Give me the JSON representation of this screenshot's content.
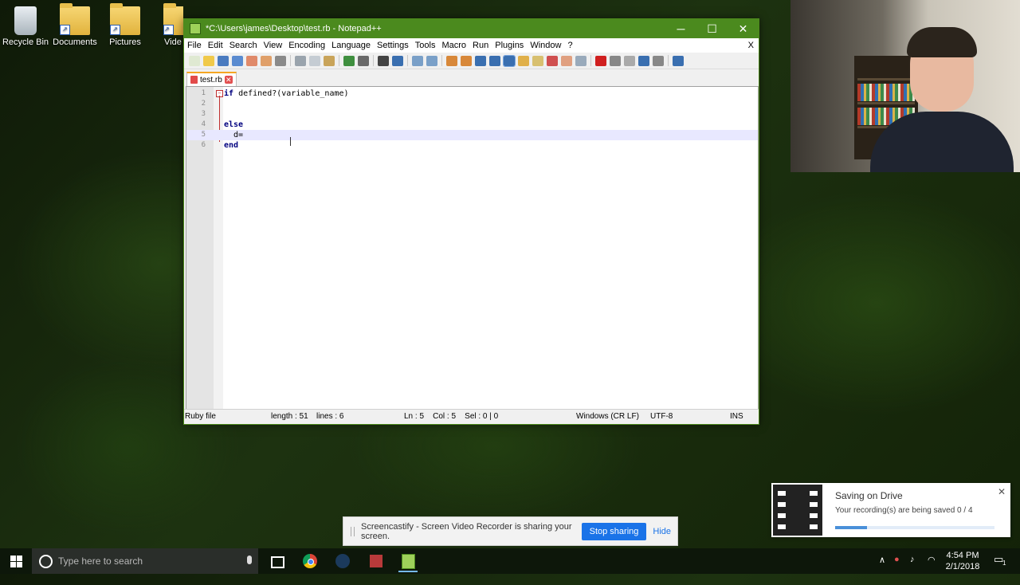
{
  "desktop_icons": [
    {
      "label": "Recycle Bin",
      "icon": "recycle-bin-icon"
    },
    {
      "label": "Documents",
      "icon": "folder-icon"
    },
    {
      "label": "Pictures",
      "icon": "folder-icon"
    },
    {
      "label": "Vide",
      "icon": "folder-icon"
    }
  ],
  "window": {
    "title": "*C:\\Users\\james\\Desktop\\test.rb - Notepad++",
    "menu": [
      "File",
      "Edit",
      "Search",
      "View",
      "Encoding",
      "Language",
      "Settings",
      "Tools",
      "Macro",
      "Run",
      "Plugins",
      "Window",
      "?"
    ],
    "menu_close": "X",
    "tab": {
      "label": "test.rb"
    },
    "lines": [
      {
        "num": "1",
        "kw": "if",
        "rest": " defined?(variable_name)"
      },
      {
        "num": "2",
        "kw": "",
        "rest": ""
      },
      {
        "num": "3",
        "kw": "",
        "rest": ""
      },
      {
        "num": "4",
        "kw": "else",
        "rest": ""
      },
      {
        "num": "5",
        "kw": "",
        "rest": "  d="
      },
      {
        "num": "6",
        "kw": "end",
        "rest": ""
      }
    ],
    "status": {
      "lang": "Ruby file",
      "length": "length : 51",
      "lines": "lines : 6",
      "pos": "Ln : 5    Col : 5    Sel : 0 | 0",
      "eol": "Windows (CR LF)",
      "encoding": "UTF-8",
      "mode": "INS"
    }
  },
  "share_bar": {
    "message": "Screencastify - Screen Video Recorder is sharing your screen.",
    "stop": "Stop sharing",
    "hide": "Hide"
  },
  "saving": {
    "title": "Saving on Drive",
    "detail": "Your recording(s) are being saved 0 / 4",
    "progress": 0.2
  },
  "taskbar": {
    "search_placeholder": "Type here to search",
    "apps": [
      "task-view-icon",
      "chrome-icon",
      "steam-icon",
      "app-icon",
      "notepad-plus-plus-icon"
    ],
    "time": "4:54 PM",
    "date": "2/1/2018",
    "notifications": "1"
  },
  "colors": {
    "title_bar": "#4b8a1e",
    "keyword": "#00007f",
    "accent": "#1a73e8"
  }
}
